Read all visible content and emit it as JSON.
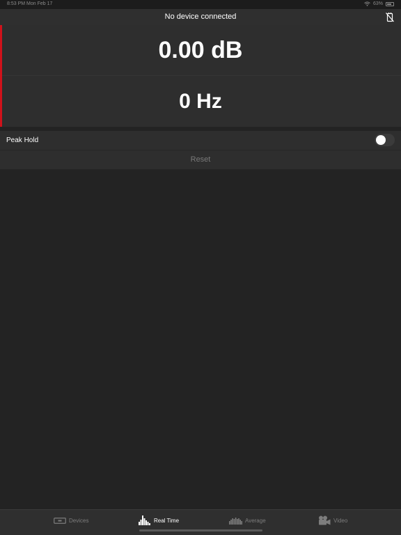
{
  "status_bar": {
    "time": "8:53 PM   Mon Feb 17",
    "battery": "63%"
  },
  "header": {
    "title": "No device connected",
    "icon": "device-disconnected-icon"
  },
  "readout": {
    "level": "0.00 dB",
    "frequency": "0 Hz",
    "accent_color": "#d0121b"
  },
  "peak_hold": {
    "label": "Peak Hold",
    "enabled": false
  },
  "reset": {
    "label": "Reset"
  },
  "tabs": [
    {
      "label": "Devices",
      "icon": "devices-icon",
      "active": false
    },
    {
      "label": "Real Time",
      "icon": "real-time-icon",
      "active": true
    },
    {
      "label": "Average",
      "icon": "average-icon",
      "active": false
    },
    {
      "label": "Video",
      "icon": "video-icon",
      "active": false
    }
  ]
}
